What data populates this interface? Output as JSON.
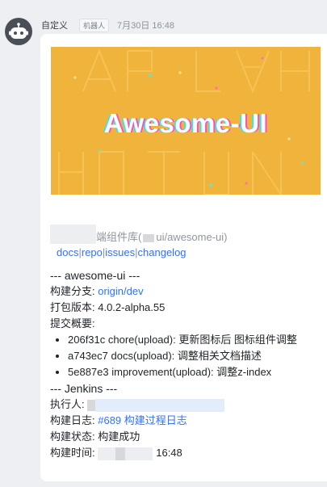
{
  "message": {
    "sender": "自定义",
    "badge": "机器人",
    "time": "7月30日 16:48",
    "avatar_icon": "robot-icon"
  },
  "banner": {
    "title": "Awesome-UI",
    "background_color": "#f0b43c"
  },
  "card": {
    "repo_desc_suffix": "端组件库(",
    "repo_path": "ui/awesome-ui)",
    "links": [
      "docs",
      "repo",
      "issues",
      "changelog"
    ],
    "section1_title": "--- awesome-ui ---",
    "branch_label": "构建分支: ",
    "branch_value": "origin/dev",
    "version_label": "打包版本: ",
    "version_value": "4.0.2-alpha.55",
    "summary_label": "提交概要:",
    "commits": [
      "206f31c chore(upload): 更新图标后 图标组件调整",
      "a743ec7 docs(upload): 调整相关文档描述",
      "5e887e3 improvement(upload): 调整z-index"
    ],
    "section2_title": "--- Jenkins ---",
    "executor_label": "执行人: ",
    "log_label": "构建日志: ",
    "log_value": "#689 构建过程日志",
    "status_label": "构建状态: ",
    "status_value": "构建成功",
    "time_label": "构建时间: ",
    "time_value": "16:48"
  },
  "colors": {
    "link": "#3370ff",
    "page_bg": "#eeeff2"
  }
}
